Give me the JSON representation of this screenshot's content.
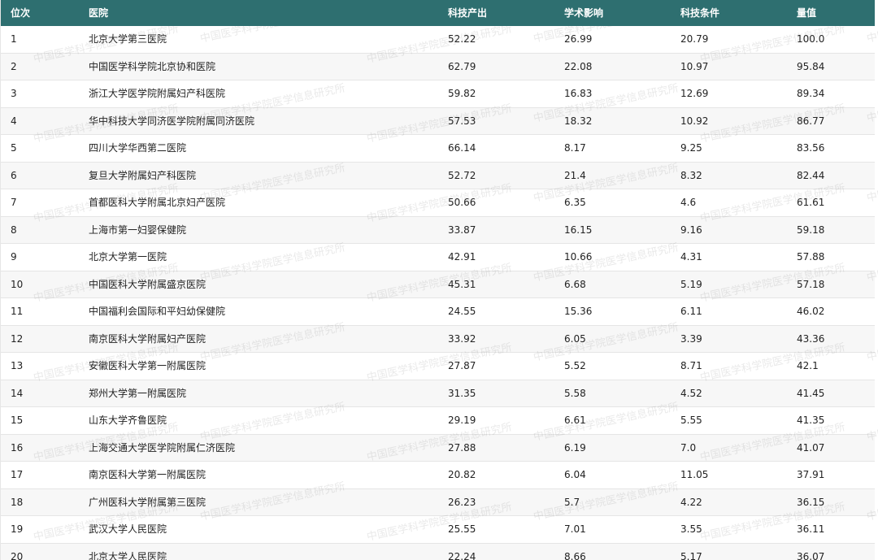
{
  "table": {
    "headers": [
      "位次",
      "医院",
      "科技产出",
      "学术影响",
      "科技条件",
      "量值"
    ],
    "rows": [
      [
        "1",
        "北京大学第三医院",
        "52.22",
        "26.99",
        "20.79",
        "100.0"
      ],
      [
        "2",
        "中国医学科学院北京协和医院",
        "62.79",
        "22.08",
        "10.97",
        "95.84"
      ],
      [
        "3",
        "浙江大学医学院附属妇产科医院",
        "59.82",
        "16.83",
        "12.69",
        "89.34"
      ],
      [
        "4",
        "华中科技大学同济医学院附属同济医院",
        "57.53",
        "18.32",
        "10.92",
        "86.77"
      ],
      [
        "5",
        "四川大学华西第二医院",
        "66.14",
        "8.17",
        "9.25",
        "83.56"
      ],
      [
        "6",
        "复旦大学附属妇产科医院",
        "52.72",
        "21.4",
        "8.32",
        "82.44"
      ],
      [
        "7",
        "首都医科大学附属北京妇产医院",
        "50.66",
        "6.35",
        "4.6",
        "61.61"
      ],
      [
        "8",
        "上海市第一妇婴保健院",
        "33.87",
        "16.15",
        "9.16",
        "59.18"
      ],
      [
        "9",
        "北京大学第一医院",
        "42.91",
        "10.66",
        "4.31",
        "57.88"
      ],
      [
        "10",
        "中国医科大学附属盛京医院",
        "45.31",
        "6.68",
        "5.19",
        "57.18"
      ],
      [
        "11",
        "中国福利会国际和平妇幼保健院",
        "24.55",
        "15.36",
        "6.11",
        "46.02"
      ],
      [
        "12",
        "南京医科大学附属妇产医院",
        "33.92",
        "6.05",
        "3.39",
        "43.36"
      ],
      [
        "13",
        "安徽医科大学第一附属医院",
        "27.87",
        "5.52",
        "8.71",
        "42.1"
      ],
      [
        "14",
        "郑州大学第一附属医院",
        "31.35",
        "5.58",
        "4.52",
        "41.45"
      ],
      [
        "15",
        "山东大学齐鲁医院",
        "29.19",
        "6.61",
        "5.55",
        "41.35"
      ],
      [
        "16",
        "上海交通大学医学院附属仁济医院",
        "27.88",
        "6.19",
        "7.0",
        "41.07"
      ],
      [
        "17",
        "南京医科大学第一附属医院",
        "20.82",
        "6.04",
        "11.05",
        "37.91"
      ],
      [
        "18",
        "广州医科大学附属第三医院",
        "26.23",
        "5.7",
        "4.22",
        "36.15"
      ],
      [
        "19",
        "武汉大学人民医院",
        "25.55",
        "7.01",
        "3.55",
        "36.11"
      ],
      [
        "20",
        "北京大学人民医院",
        "22.24",
        "8.66",
        "5.17",
        "36.07"
      ]
    ]
  },
  "watermark": {
    "text": "中国医学科学院医学信息研究所"
  },
  "colors": {
    "header_bg": "#2e6f70",
    "header_text": "#ffffff",
    "row_alt_bg": "#f7f7f7",
    "border": "#e5e5e5"
  }
}
